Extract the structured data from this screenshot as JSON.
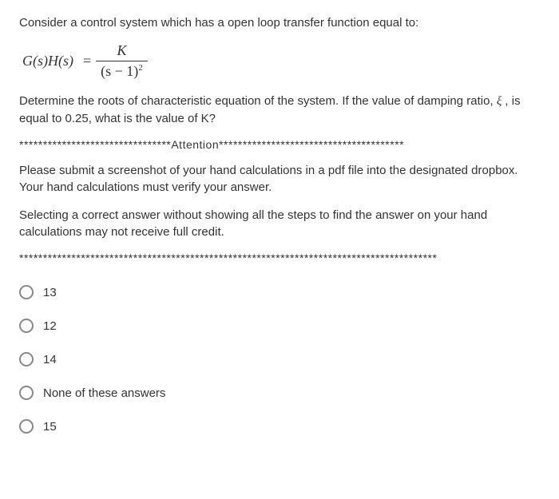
{
  "question": {
    "intro": "Consider a control system which has a open loop transfer function equal to:",
    "formula": {
      "lhs": "G(s)H(s)",
      "numerator": "K",
      "denominator_base": "(s − 1)",
      "denominator_exp": "2"
    },
    "prompt_part1": "Determine the roots of characteristic equation of the system. If the value of damping ratio, ",
    "prompt_xi": "ξ",
    "prompt_part2": " , is equal to 0.25, what is the value of K?",
    "attention_stars_left": "********************************",
    "attention_word": "Attention",
    "attention_stars_right": "***************************************",
    "instructions1": "Please submit a screenshot of your hand calculations in a pdf file into the designated dropbox. Your hand calculations must verify your answer.",
    "instructions2": "Selecting a correct answer without showing all the steps to find the answer on your hand calculations may not receive full credit.",
    "stars_row": "****************************************************************************************"
  },
  "options": [
    {
      "label": "13"
    },
    {
      "label": "12"
    },
    {
      "label": "14"
    },
    {
      "label": "None of these answers"
    },
    {
      "label": "15"
    }
  ]
}
